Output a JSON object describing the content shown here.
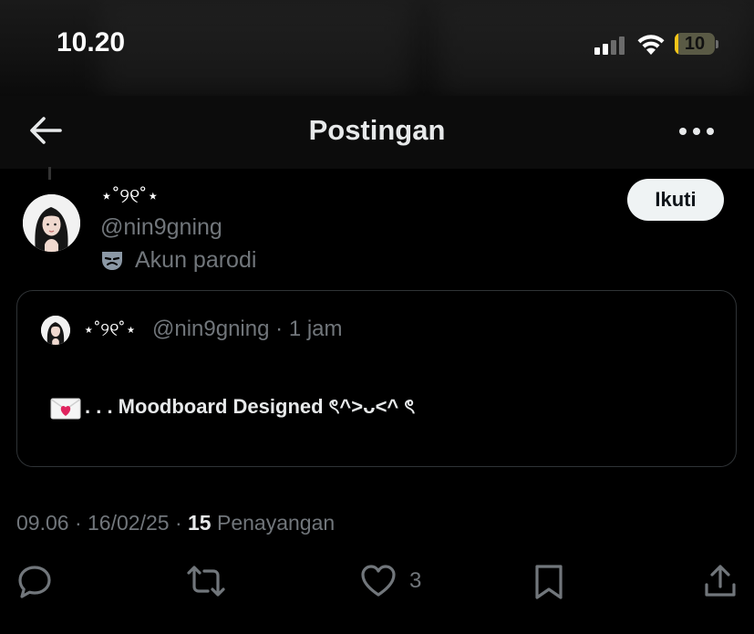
{
  "status_bar": {
    "time": "10.20",
    "battery_percent": "10",
    "battery_level": 0.1,
    "signal_bars_active": 2,
    "signal_bars_total": 4
  },
  "nav": {
    "title": "Postingan",
    "back_icon": "arrow-left-icon",
    "more_icon": "more-horizontal-icon"
  },
  "post": {
    "display_name": "⋆˚୨୧˚⋆",
    "handle": "@nin9gning",
    "parody_icon": "theater-mask-icon",
    "parody_label": "Akun parodi",
    "follow_label": "Ikuti"
  },
  "quote": {
    "display_name": "⋆˚୨୧˚⋆",
    "handle": "@nin9gning",
    "separator": "·",
    "time": "1 jam",
    "text_icon": "love-letter-icon",
    "text": ". . . Moodboard Designed ৎ^>ᴗ<^ ৎ"
  },
  "meta": {
    "time": "09.06",
    "sep1": "·",
    "date": "16/02/25",
    "sep2": "·",
    "views_count": "15",
    "views_label": "Penayangan"
  },
  "actions": {
    "reply_icon": "reply-icon",
    "repost_icon": "repost-icon",
    "like_icon": "heart-icon",
    "like_count": "3",
    "bookmark_icon": "bookmark-icon",
    "share_icon": "share-icon"
  },
  "colors": {
    "background": "#000000",
    "text_primary": "#e7e9ea",
    "text_secondary": "#71767b",
    "border": "#2f3336",
    "follow_bg": "#eff3f4",
    "battery": "#f5c518"
  }
}
